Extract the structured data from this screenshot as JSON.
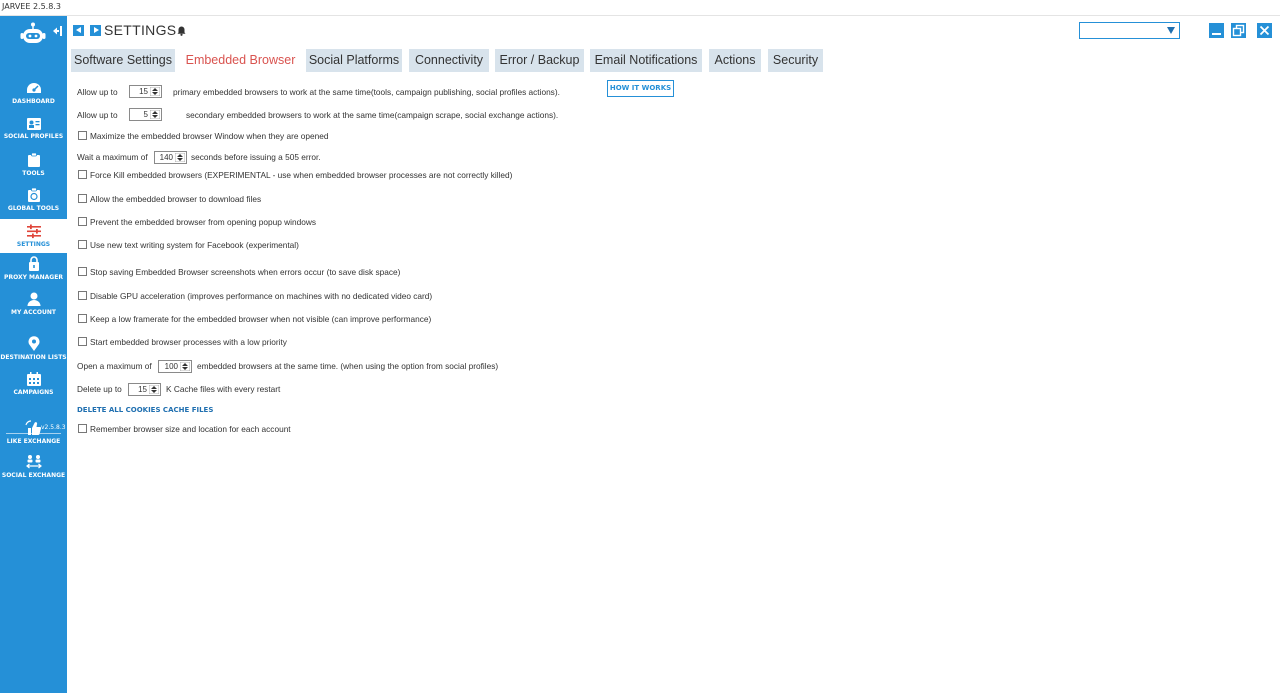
{
  "app": {
    "title": "JARVEE 2.5.8.3"
  },
  "sidebar": {
    "items": [
      {
        "label": "DASHBOARD",
        "icon": "dashboard-icon"
      },
      {
        "label": "SOCIAL PROFILES",
        "icon": "social-profiles-icon"
      },
      {
        "label": "TOOLS",
        "icon": "tools-icon"
      },
      {
        "label": "GLOBAL TOOLS",
        "icon": "global-tools-icon"
      },
      {
        "label": "SETTINGS",
        "icon": "settings-sliders-icon",
        "active": true
      },
      {
        "label": "PROXY MANAGER",
        "icon": "proxy-manager-icon"
      },
      {
        "label": "MY ACCOUNT",
        "icon": "user-icon"
      },
      {
        "label": "DESTINATION LISTS",
        "icon": "location-pin-icon"
      },
      {
        "label": "CAMPAIGNS",
        "icon": "calendar-icon"
      },
      {
        "label": "LIKE EXCHANGE",
        "icon": "like-exchange-icon"
      },
      {
        "label": "SOCIAL EXCHANGE",
        "icon": "social-exchange-icon"
      }
    ],
    "version": "v2.5.8.3"
  },
  "header": {
    "title": "SETTINGS",
    "select_value": ""
  },
  "tabs": [
    {
      "label": "Software Settings"
    },
    {
      "label": "Embedded Browser",
      "active": true
    },
    {
      "label": "Social Platforms"
    },
    {
      "label": "Connectivity"
    },
    {
      "label": "Error / Backup"
    },
    {
      "label": "Email Notifications"
    },
    {
      "label": "Actions"
    },
    {
      "label": "Security"
    }
  ],
  "settings": {
    "primary": {
      "prefix": "Allow up to",
      "value": "15",
      "suffix": "primary embedded browsers to work at the same time(tools, campaign publishing, social profiles actions)."
    },
    "how_it_works": "HOW IT WORKS",
    "secondary": {
      "prefix": "Allow up to",
      "value": "5",
      "suffix": "secondary embedded browsers to work at the same time(campaign scrape, social exchange actions)."
    },
    "maximize": {
      "label": "Maximize the embedded browser Window when they are opened",
      "checked": false
    },
    "wait": {
      "prefix": "Wait a maximum of",
      "value": "140",
      "suffix": "seconds before issuing a 505 error."
    },
    "force_kill": {
      "label": "Force Kill embedded browsers (EXPERIMENTAL - use when embedded browser processes are not correctly killed)",
      "checked": false
    },
    "allow_download": {
      "label": "Allow the embedded browser to download files",
      "checked": false
    },
    "prevent_popup": {
      "label": "Prevent the embedded browser from opening popup windows",
      "checked": false
    },
    "new_text_writing": {
      "label": "Use new text writing system for Facebook (experimental)",
      "checked": false
    },
    "stop_screenshots": {
      "label": "Stop saving Embedded Browser screenshots when errors occur (to save disk space)",
      "checked": false
    },
    "disable_gpu": {
      "label": "Disable GPU acceleration (improves performance on machines with no dedicated video card)",
      "checked": false
    },
    "low_framerate": {
      "label": "Keep a low framerate for the embedded browser when not visible (can improve performance)",
      "checked": false
    },
    "low_priority": {
      "label": "Start embedded browser processes with a low priority",
      "checked": false
    },
    "open_max": {
      "prefix": "Open a maximum of",
      "value": "100",
      "suffix": "embedded browsers at the same time. (when using the option from social profiles)"
    },
    "delete_cache": {
      "prefix": "Delete up to",
      "value": "15",
      "suffix": "K Cache files with every restart"
    },
    "delete_cookies_link": "DELETE ALL COOKIES CACHE FILES",
    "remember_size": {
      "label": "Remember browser size and location for each account",
      "checked": false
    }
  },
  "colors": {
    "accent": "#2590d7",
    "active_tab_text": "#d9534f",
    "tab_bg": "#d8e3ec",
    "link": "#1f6fb0"
  }
}
